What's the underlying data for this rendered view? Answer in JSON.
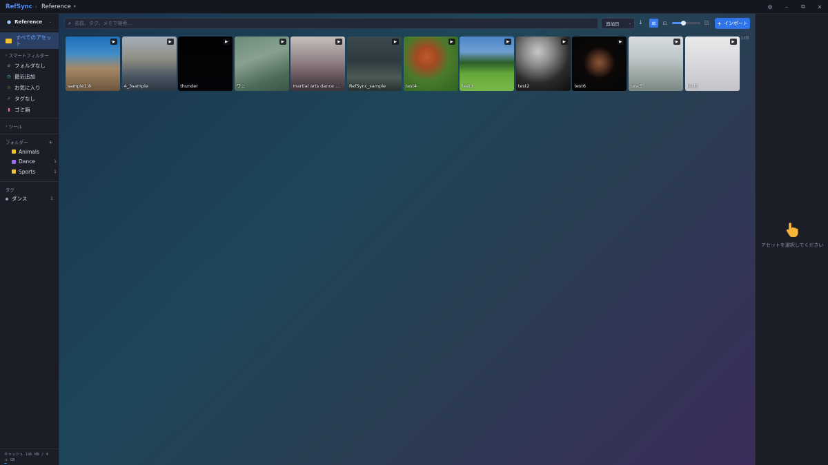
{
  "titlebar": {
    "brand": "RefSync",
    "crumb_sep": "›",
    "library": "Reference",
    "controls": [
      "⚙",
      "–",
      "⧉",
      "✕"
    ]
  },
  "sidebar": {
    "library_name": "Reference",
    "all_assets": "すべてのアセット",
    "smart_filters_header": "スマートフィルター",
    "smart_filters": [
      {
        "label": "フォルダなし",
        "icon": "folder-off-icon",
        "color": "#8a90a0"
      },
      {
        "label": "最近追加",
        "icon": "clock-icon",
        "color": "#4fc3c0"
      },
      {
        "label": "お気に入り",
        "icon": "star-icon",
        "color": "#f2c230"
      },
      {
        "label": "タグなし",
        "icon": "tag-off-icon",
        "color": "#8a90a0"
      },
      {
        "label": "ゴミ箱",
        "icon": "trash-icon",
        "color": "#e26a8a"
      }
    ],
    "tools_header": "ツール",
    "folders_header": "フォルダー",
    "folders": [
      {
        "label": "Animals",
        "count": "",
        "color": "#f2c230"
      },
      {
        "label": "Dance",
        "count": "1",
        "color": "#9b6cf0"
      },
      {
        "label": "Sports",
        "count": "1",
        "color": "#f2c230"
      }
    ],
    "tags_header": "タグ",
    "tags": [
      {
        "label": "ダンス",
        "count": "1"
      }
    ],
    "cache_line1": "キャッシュ 196 MB / 4",
    "cache_line2": "ュ   GB",
    "cache_fraction": 0.05
  },
  "toolbar": {
    "search_placeholder": "名前、タグ、メモで検索...",
    "sort_label": "追加日",
    "sort_dir_icon": "↓",
    "import_label": "インポート",
    "size_value": 0.4
  },
  "grid": {
    "count_label": "12件",
    "items": [
      {
        "name": "sample1.8",
        "bg": "linear-gradient(180deg,#1f6fb8 0%,#3f8cc8 32%,#a58a68 58%,#6e543c 100%)"
      },
      {
        "name": "4_3sample",
        "bg": "linear-gradient(180deg,#a5afba 0%,#8e8c82 42%,#4c5864 72%,#2b3742 100%)"
      },
      {
        "name": "thunder",
        "bg": "linear-gradient(180deg,#020204 0%,#050508 100%)"
      },
      {
        "name": "ワニ",
        "bg": "linear-gradient(160deg,#6c8d7c 0%,#89a090 40%,#4e6b58 75%,#3c5647 100%)"
      },
      {
        "name": "martial arts dance movement",
        "bg": "linear-gradient(180deg,#c4c0bd 0%,#8e7e82 48%,#5a4a52 80%,#3e343a 100%)"
      },
      {
        "name": "RefSync_sample",
        "bg": "linear-gradient(180deg,#3b4a50 0%,#2e3a3e 45%,#4a5a54 75%,#283230 100%)"
      },
      {
        "name": "test4",
        "bg": "radial-gradient(circle at 42% 38%,#c05a2a 0%,#a34a22 22%,#4a7a2c 50%,#2f6420 100%)"
      },
      {
        "name": "test3",
        "bg": "linear-gradient(180deg,#4e86c8 0%,#6d9ed0 28%,#2c5e2a 48%,#65a83a 68%,#78b84a 100%)"
      },
      {
        "name": "test2",
        "bg": "radial-gradient(circle at 40% 28%,#c8c8c8 0%,#8a8a8a 28%,#2a2a2a 62%,#0e0e0e 100%)"
      },
      {
        "name": "test6",
        "bg": "radial-gradient(circle at 50% 48%,#8a5638 0%,#5a3422 18%,#0c0808 40%,#040404 100%)"
      },
      {
        "name": "test5",
        "bg": "linear-gradient(180deg,#d8dde0 0%,#bdc6c8 40%,#9aa6a2 72%,#7b8883 100%)"
      },
      {
        "name": "test1",
        "bg": "linear-gradient(180deg,#eaeaec 0%,#d6d6da 55%,#c4c4c8 100%)"
      }
    ]
  },
  "rpanel": {
    "empty_message": "アセットを選択してください"
  }
}
